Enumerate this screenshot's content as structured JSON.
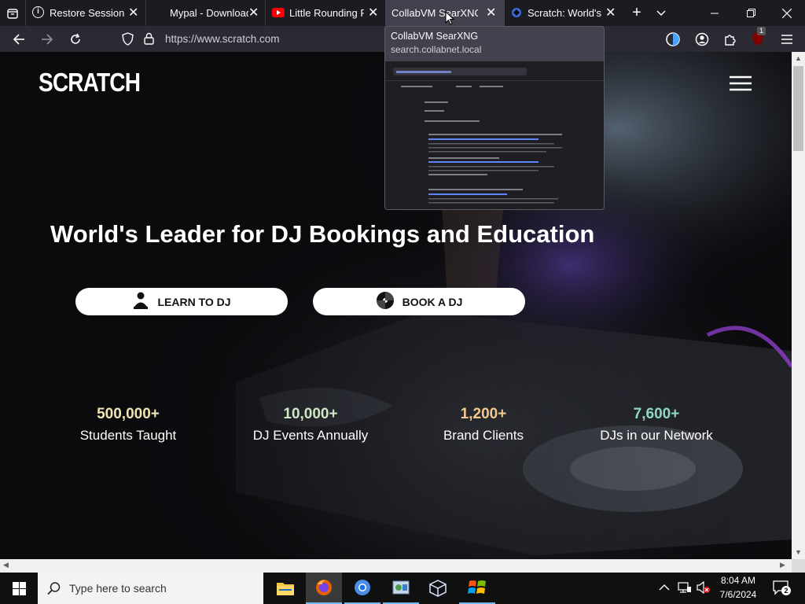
{
  "tabs": [
    {
      "title": "Restore Session"
    },
    {
      "title": "Mypal - Download"
    },
    {
      "title": "Little Rounding P"
    },
    {
      "title": "CollabVM SearXNG"
    },
    {
      "title": "Scratch: World's L"
    }
  ],
  "tooltip": {
    "title": "CollabVM SearXNG",
    "url": "search.collabnet.local"
  },
  "address": {
    "url": "https://www.scratch.com"
  },
  "extension_badge": "1",
  "site": {
    "logo": "SCRATCH",
    "headline": "World's Leader for DJ Bookings and Education",
    "learn_label": "LEARN TO DJ",
    "book_label": "BOOK A DJ",
    "stats": [
      {
        "number": "500,000+",
        "label": "Students Taught",
        "color": "#f1e4b3"
      },
      {
        "number": "10,000+",
        "label": "DJ Events Annually",
        "color": "#cfe6c5"
      },
      {
        "number": "1,200+",
        "label": "Brand Clients",
        "color": "#f3c98b"
      },
      {
        "number": "7,600+",
        "label": "DJs in our Network",
        "color": "#8fd8c0"
      }
    ]
  },
  "taskbar": {
    "search_placeholder": "Type here to search",
    "time": "8:04 AM",
    "date": "7/6/2024",
    "notification_count": "2"
  },
  "colors": {
    "accent": "#00b3f4",
    "tab_active": "#42414d",
    "chrome_bg": "#1c1b22",
    "toolbar": "#2b2a33"
  }
}
